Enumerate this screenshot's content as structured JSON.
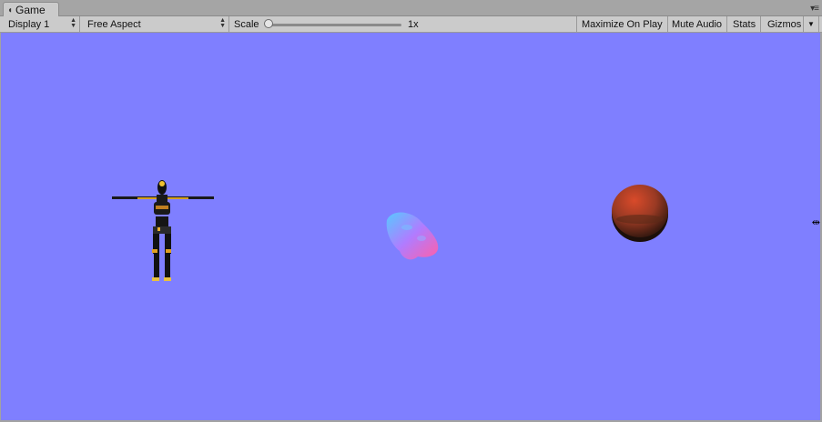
{
  "tab": {
    "title": "Game",
    "icon": "pacman-game-icon"
  },
  "tab_menu_icon": "panel-menu-icon",
  "toolbar": {
    "display": "Display 1",
    "aspect": "Free Aspect",
    "scale_label": "Scale",
    "scale_value": "1x",
    "scale_level": 0,
    "maximize_on_play": "Maximize On Play",
    "mute_audio": "Mute Audio",
    "stats": "Stats",
    "gizmos": "Gizmos"
  },
  "scene": {
    "background": "#7f7fff",
    "objects": [
      "robot-character",
      "human-head-mesh",
      "red-sphere"
    ]
  }
}
